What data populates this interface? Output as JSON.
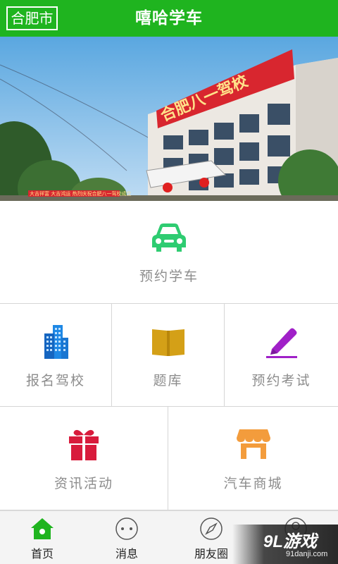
{
  "header": {
    "city": "合肥市",
    "title": "嘻哈学车"
  },
  "banner": {
    "sign_text": "合肥八一驾校",
    "banner_text": "大吉祥富 大吉鸿运 热烈庆祝合肥八一驾校成立"
  },
  "features": {
    "top": {
      "label": "预约学车",
      "icon": "car-icon",
      "color": "#2ecc71"
    },
    "grid": [
      {
        "label": "报名驾校",
        "icon": "building-icon",
        "color": "#1e88e5"
      },
      {
        "label": "题库",
        "icon": "book-icon",
        "color": "#d4a017"
      },
      {
        "label": "预约考试",
        "icon": "pen-icon",
        "color": "#a020c8"
      },
      {
        "label": "资讯活动",
        "icon": "gift-icon",
        "color": "#d81b3c"
      },
      {
        "label": "汽车商城",
        "icon": "store-icon",
        "color": "#f39c3c"
      }
    ]
  },
  "nav": {
    "items": [
      {
        "label": "首页",
        "icon": "home-icon",
        "active": true
      },
      {
        "label": "消息",
        "icon": "message-icon"
      },
      {
        "label": "朋友圈",
        "icon": "compass-icon"
      },
      {
        "label": "",
        "icon": "profile-icon"
      }
    ],
    "active_color": "#1fb41f"
  },
  "watermark": {
    "main": "9L游戏",
    "sub": "91danji.com"
  }
}
